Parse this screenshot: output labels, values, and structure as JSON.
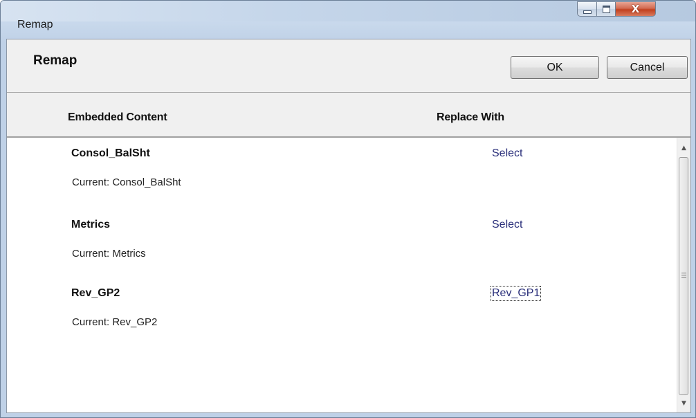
{
  "window": {
    "title": "Remap",
    "controls": {
      "minimize_icon": "minimize-icon",
      "maximize_icon": "maximize-icon",
      "close_icon": "close-icon",
      "close_glyph": "X"
    }
  },
  "header": {
    "title": "Remap",
    "ok_label": "OK",
    "cancel_label": "Cancel",
    "columns": {
      "embedded": "Embedded Content",
      "replace": "Replace With"
    }
  },
  "rows": [
    {
      "name": "Consol_BalSht",
      "current": "Current: Consol_BalSht",
      "action": "Select"
    },
    {
      "name": "Metrics",
      "current": "Current: Metrics",
      "action": "Select"
    },
    {
      "name": "Rev_GP2",
      "current": "Current: Rev_GP2",
      "action": "Rev_GP1"
    }
  ],
  "scrollbar": {
    "up_icon": "scroll-up-arrow-icon",
    "down_icon": "scroll-down-arrow-icon",
    "grip_icon": "scroll-grip-icon"
  },
  "colors": {
    "link": "#2a2f7a",
    "close_button": "#c2401f",
    "header_bg": "#f0f0f0"
  }
}
